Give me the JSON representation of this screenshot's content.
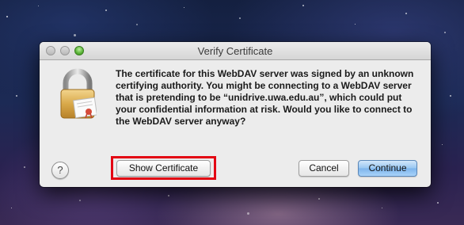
{
  "dialog": {
    "title": "Verify Certificate",
    "message": "The certificate for this WebDAV server was signed by an unknown certifying authority. You might be connecting to a WebDAV server that is pretending to be “unidrive.uwa.edu.au”, which could put your confidential information at risk. Would you like to connect to the WebDAV server anyway?",
    "icon": "lock-certificate-icon",
    "help_label": "?",
    "buttons": {
      "show_certificate": "Show Certificate",
      "cancel": "Cancel",
      "continue": "Continue"
    }
  },
  "colors": {
    "highlight": "#e30613",
    "default_button": "#7cb4ec"
  }
}
